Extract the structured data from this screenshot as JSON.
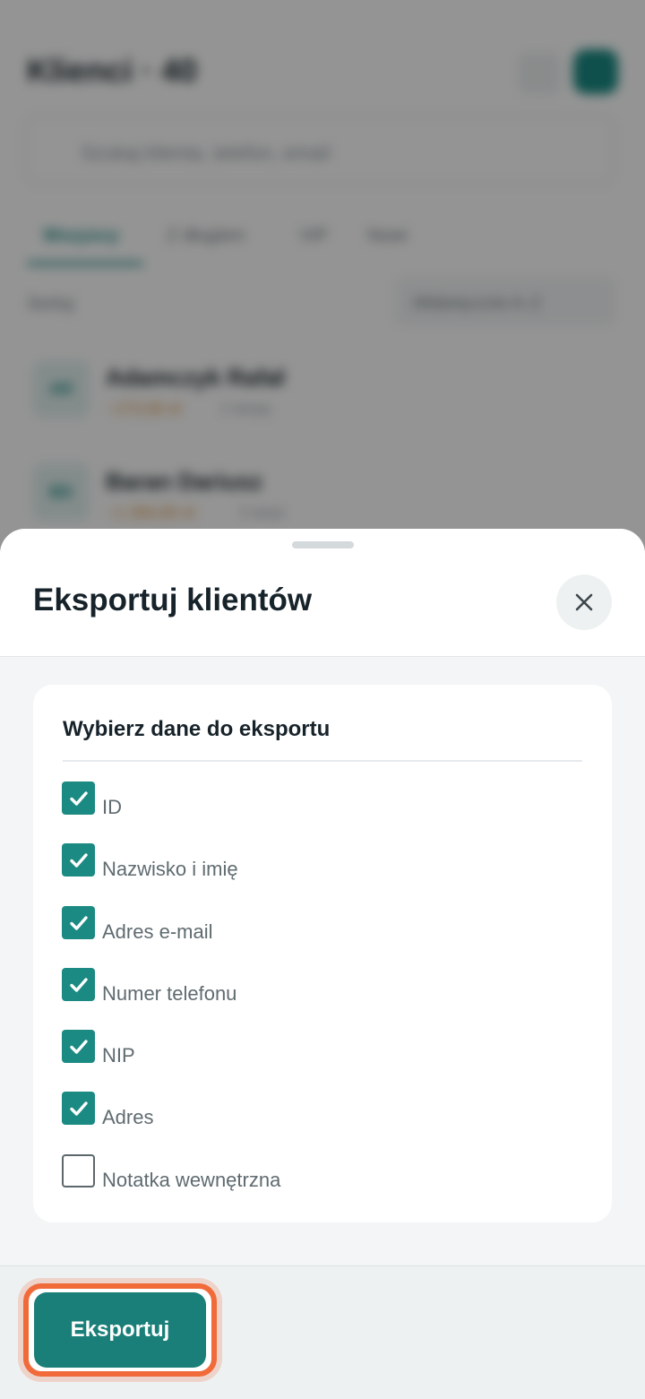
{
  "background": {
    "title": "Klienci · 40",
    "search_placeholder": "Szukaj klienta, telefon, email",
    "tabs": [
      "Wszyscy",
      "Z długiem",
      "VIP",
      "Nowi"
    ],
    "sort_label": "Sortuj",
    "sort_value": "Alfabetycznie A–Z",
    "clients": [
      {
        "initials": "AR",
        "name": "Adamczyk Rafał",
        "amount": "−172,00 zł",
        "meta": "2 wizyty"
      },
      {
        "initials": "BD",
        "name": "Baran Dariusz",
        "amount": "−1 284,00 zł",
        "meta": "5 wizyt"
      }
    ]
  },
  "sheet": {
    "title": "Eksportuj klientów",
    "close_icon": "close-icon",
    "section_title": "Wybierz dane do eksportu",
    "options": [
      {
        "label": "ID",
        "checked": true
      },
      {
        "label": "Nazwisko i imię",
        "checked": true
      },
      {
        "label": "Adres e-mail",
        "checked": true
      },
      {
        "label": "Numer telefonu",
        "checked": true
      },
      {
        "label": "NIP",
        "checked": true
      },
      {
        "label": "Adres",
        "checked": true
      },
      {
        "label": "Notatka wewnętrzna",
        "checked": false
      }
    ],
    "export_label": "Eksportuj"
  },
  "colors": {
    "accent": "#1a8a83",
    "button": "#1a7f78",
    "highlight": "#f06a3a"
  }
}
